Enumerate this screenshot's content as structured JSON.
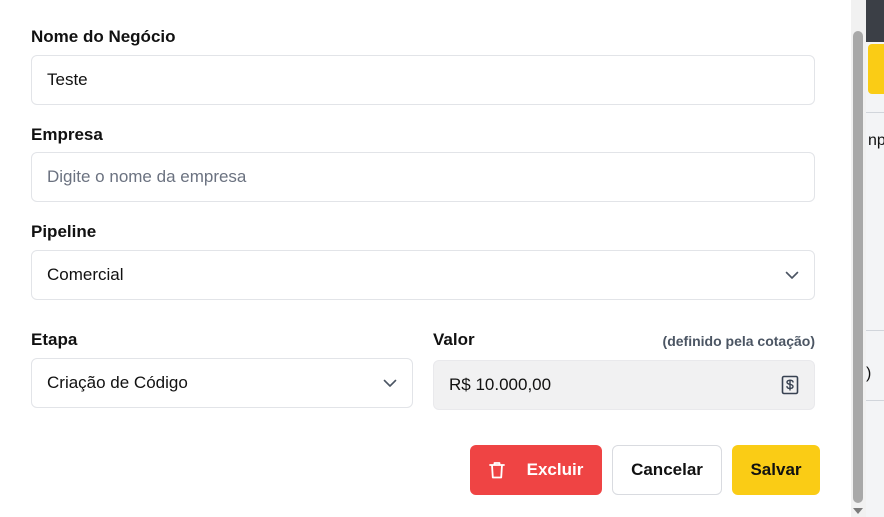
{
  "form": {
    "nome_negocio": {
      "label": "Nome do Negócio",
      "value": "Teste"
    },
    "empresa": {
      "label": "Empresa",
      "placeholder": "Digite o nome da empresa"
    },
    "pipeline": {
      "label": "Pipeline",
      "value": "Comercial"
    },
    "etapa": {
      "label": "Etapa",
      "value": "Criação de Código"
    },
    "valor": {
      "label": "Valor",
      "hint": "(definido pela cotação)",
      "value": "R$ 10.000,00"
    }
  },
  "actions": {
    "delete_label": "Excluir",
    "cancel_label": "Cancelar",
    "save_label": "Salvar"
  },
  "background": {
    "partial_label_1": "np",
    "partial_label_2": ")"
  },
  "colors": {
    "danger": "#ef4444",
    "primary": "#facc15",
    "readonly_bg": "#f1f1f2"
  },
  "icons": [
    "chevron-down-icon",
    "trash-icon",
    "dollar-receipt-icon"
  ]
}
